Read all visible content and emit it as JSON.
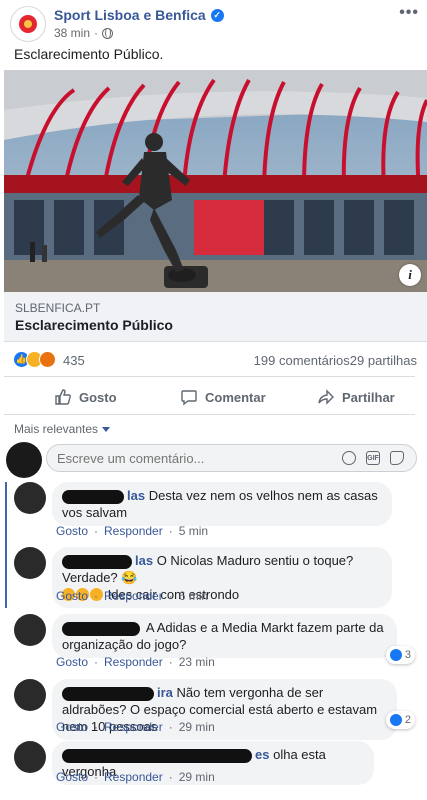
{
  "post": {
    "page_name": "Sport Lisboa e Benfica",
    "time": "38 min",
    "more_label": "•••",
    "text": "Esclarecimento Público.",
    "link": {
      "domain": "SLBENFICA.PT",
      "title": "Esclarecimento Público",
      "info_label": "i"
    },
    "reactions": {
      "icons": [
        "like-icon",
        "haha-icon",
        "angry-icon"
      ],
      "count": "435"
    },
    "comments_count": "199 comentários",
    "shares_count": "29 partilhas",
    "actions": {
      "like": "Gosto",
      "comment": "Comentar",
      "share": "Partilhar"
    }
  },
  "comments_section": {
    "sort_label": "Mais relevantes",
    "composer_placeholder": "Escreve um comentário...",
    "gif_label": "GIF",
    "comments": [
      {
        "author_tail": "las",
        "text": "Desta vez nem os velhos nem as casas vos salvam",
        "like": "Gosto",
        "reply": "Responder",
        "time": "5 min",
        "reaction_count": ""
      },
      {
        "author_tail": "las",
        "text": "O Nicolas Maduro sentiu o toque? Verdade? 😂",
        "text2": "Ides cair com estrondo",
        "like": "Gosto",
        "reply": "Responder",
        "time": "6 min",
        "reaction_count": ""
      },
      {
        "author_tail": "",
        "text": "A Adidas e a Media Markt fazem parte da organização do jogo?",
        "like": "Gosto",
        "reply": "Responder",
        "time": "23 min",
        "reaction_count": "3"
      },
      {
        "author_tail": "ira",
        "text": "Não tem vergonha de ser aldrabões? O espaço comercial está aberto e estavam nem 10 pessoas",
        "like": "Gosto",
        "reply": "Responder",
        "time": "29 min",
        "reaction_count": "2"
      },
      {
        "author_tail": "es",
        "text": "olha esta vergonha",
        "like": "Gosto",
        "reply": "Responder",
        "time": "29 min",
        "reaction_count": ""
      }
    ]
  },
  "colors": {
    "brand_link": "#385898",
    "accent": "#1877f2",
    "muted": "#606770"
  }
}
